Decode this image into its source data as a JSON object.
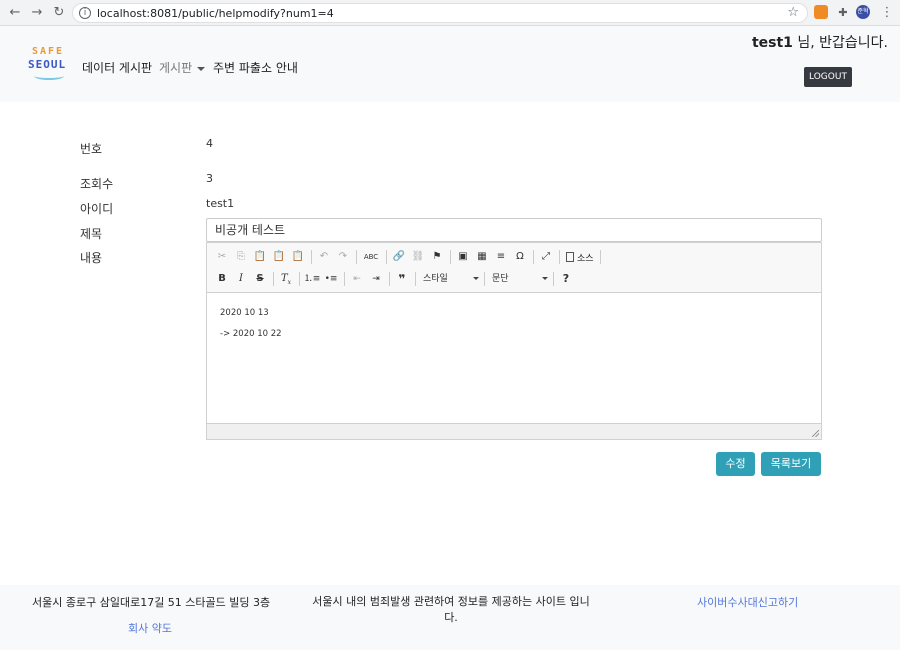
{
  "browser": {
    "url": "localhost:8081/public/helpmodify?num1=4",
    "back_icon": "←",
    "forward_icon": "→",
    "reload_icon": "↻",
    "info_icon": "i",
    "star_icon": "☆",
    "menu_icon": "⋮",
    "puzzle_icon": "✚",
    "profile_initials": "준혁"
  },
  "header": {
    "logo_top": "SAFE",
    "logo_bottom": "SEOUL",
    "nav_items": [
      "데이터 게시판",
      "게시판",
      "주변 파출소 안내"
    ],
    "greeting_user": "test1",
    "greeting_suffix": " 님, 반갑습니다.",
    "logout_label": "LOGOUT"
  },
  "form": {
    "labels": {
      "number": "번호",
      "views": "조회수",
      "user_id": "아이디",
      "title": "제목",
      "content": "내용"
    },
    "values": {
      "number": "4",
      "views": "3",
      "user_id": "test1",
      "title": "비공개 테스트"
    },
    "editor": {
      "toolbar_row1": [
        "✂",
        "⎘",
        "📋",
        "📋",
        "📋",
        "↶",
        "↷",
        "ABC",
        "🔗",
        "⛓",
        "⚑",
        "▣",
        "▦",
        "≡",
        "Ω",
        "⤢"
      ],
      "source_label": "소스",
      "style_label": "스타일",
      "format_label": "문단",
      "help_label": "?",
      "lines": [
        "2020 10 13",
        "-> 2020 10 22"
      ]
    },
    "buttons": {
      "modify": "수정",
      "list": "목록보기"
    }
  },
  "footer": {
    "address": "서울시 종로구 삼일대로17길 51 스타골드 빌딩 3층",
    "terms": "회사 약도",
    "description": "서울시 내의 범죄발생 관련하여 정보를 제공하는 사이트 입니다.",
    "report_link": "사이버수사대신고하기"
  }
}
